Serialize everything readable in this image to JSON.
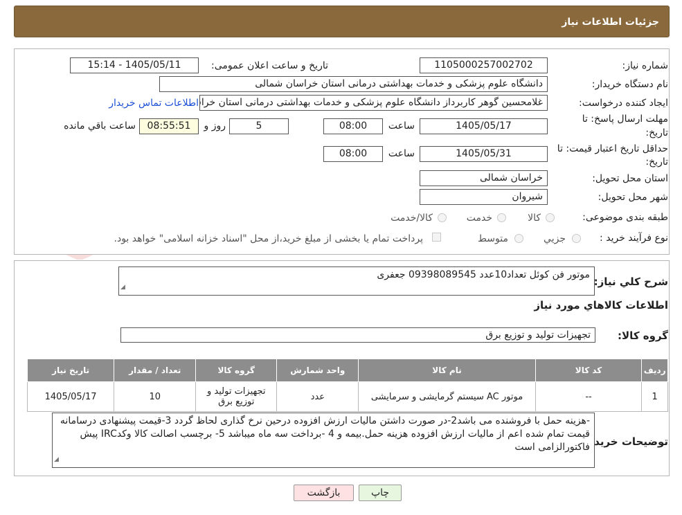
{
  "header": {
    "title": "جزئیات اطلاعات نیاز"
  },
  "form": {
    "need_number_label": "شماره نیاز:",
    "need_number": "1105000257002702",
    "announce_label": "تاریخ و ساعت اعلان عمومی:",
    "announce_value": "1405/05/11 - 15:14",
    "buyer_org_label": "نام دستگاه خریدار:",
    "buyer_org": "دانشگاه علوم پزشکی و خدمات بهداشتی درمانی استان خراسان شمالی",
    "creator_label": "ایجاد کننده درخواست:",
    "creator": "غلامحسین گوهر کاربرداز  دانشگاه علوم پزشکی و خدمات بهداشتی درمانی استان خراسان شمالی",
    "contact_link": "اطلاعات تماس خریدار",
    "deadline_label_1": "مهلت ارسال پاسخ: تا",
    "deadline_label_2": "تاریخ:",
    "deadline_date": "1405/05/17",
    "time_label": "ساعت",
    "deadline_time": "08:00",
    "days_value": "5",
    "days_label": "روز و",
    "remaining_time": "08:55:51",
    "remaining_label": "ساعت باقي مانده",
    "validity_label_1": "حداقل تاریخ اعتبار قیمت: تا",
    "validity_label_2": "تاریخ:",
    "validity_date": "1405/05/31",
    "validity_time_label": "ساعت",
    "validity_time": "08:00",
    "province_label": "استان محل تحویل:",
    "province": "خراسان شمالی",
    "city_label": "شهر محل تحویل:",
    "city": "شیروان",
    "category_label": "طبقه بندی موضوعی:",
    "category_options": [
      "کالا",
      "خدمت",
      "کالا/خدمت"
    ],
    "process_label": "نوع فرآیند خرید :",
    "process_options": [
      "جزیي",
      "متوسط"
    ],
    "payment_note": "پرداخت تمام یا بخشی از مبلغ خرید،از محل \"اسناد خزانه اسلامی\" خواهد بود."
  },
  "details": {
    "description_label": "شرح كلي نياز:",
    "description": "موتور فن کوئل تعداد10عدد 09398089545 جعفری",
    "goods_info_title": "اطلاعات كالاهاي مورد نياز",
    "goods_group_label": "گروه کالا:",
    "goods_group": "تجهیزات تولید و توزیع برق",
    "table_headers": [
      "رديف",
      "کد کالا",
      "نام کالا",
      "واحد شمارش",
      "گروه کالا",
      "تعداد / مقدار",
      "تاریخ نیاز"
    ],
    "rows": [
      {
        "row": "1",
        "code": "--",
        "name": "موتور AC سیستم گرمایشی و سرمایشی",
        "unit": "عدد",
        "group": "تجهیزات تولید و توزیع برق",
        "qty": "10",
        "date": "1405/05/17"
      }
    ],
    "buyer_notes_label": "توضیحات خریدار:",
    "buyer_notes": "-هزینه حمل با فروشنده می باشد2-در صورت داشتن مالیات ارزش افزوده درحین نرخ گذاری لحاظ گردد 3-قیمت پیشنهادی درسامانه  قیمت تمام شده اعم از مالیات ارزش افزوده هزینه حمل.بیمه و 4 -برداخت سه ماه میباشد 5- برچسب اصالت کالا وکدIRC پیش فاکتورالزامی است"
  },
  "buttons": {
    "print": "چاپ",
    "back": "بازگشت"
  },
  "watermark": {
    "text": "AriaTender.neT"
  },
  "colors": {
    "header_bg": "#8a6a3c",
    "table_header_bg": "#8d8d8d",
    "link": "#1a4fd6",
    "back_btn_bg": "#fde1e3",
    "print_btn_bg": "#e7f7df"
  }
}
